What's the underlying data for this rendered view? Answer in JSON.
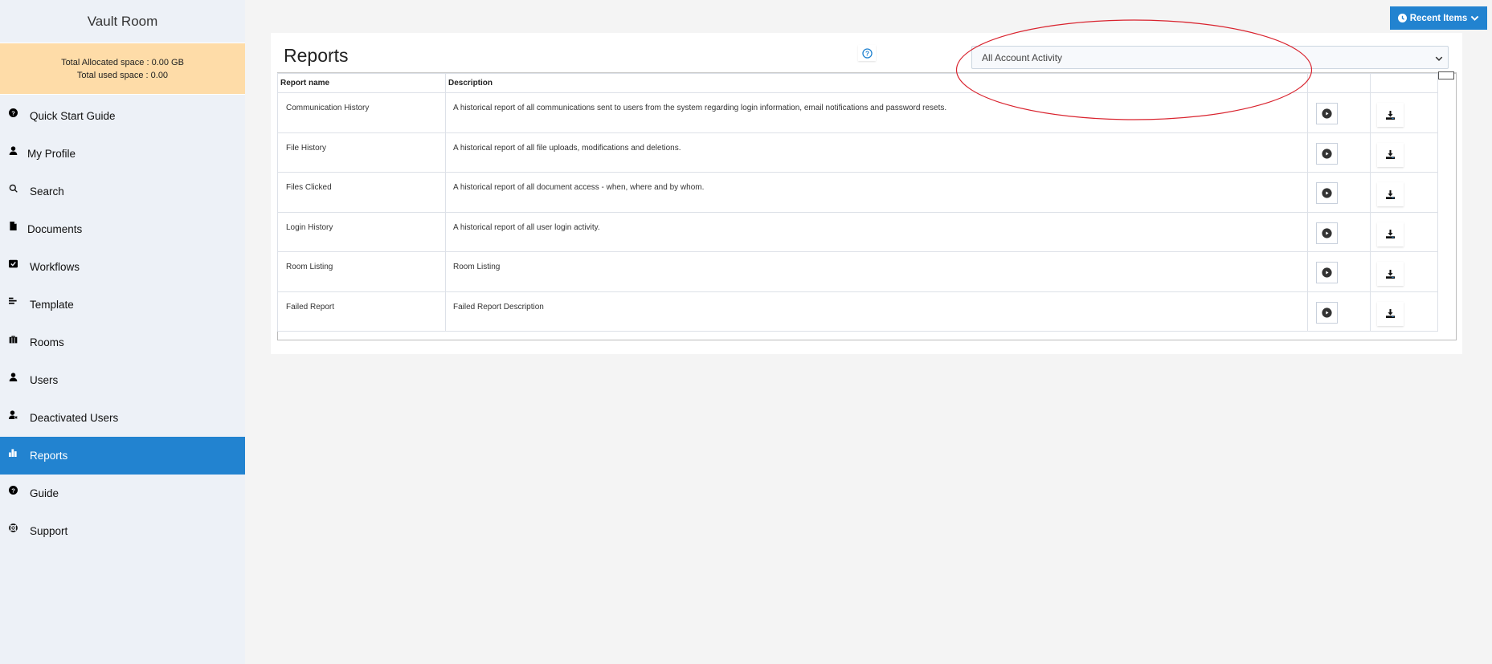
{
  "app": {
    "title": "Vault Room"
  },
  "storage": {
    "allocated": "Total Allocated space : 0.00 GB",
    "used": "Total used space : 0.00"
  },
  "sidebar": {
    "items": [
      {
        "label": "Quick Start Guide",
        "icon": "question-circle-icon",
        "active": false
      },
      {
        "label": "My Profile",
        "icon": "user-icon",
        "active": false
      },
      {
        "label": "Search",
        "icon": "search-icon",
        "active": false
      },
      {
        "label": "Documents",
        "icon": "document-icon",
        "active": false
      },
      {
        "label": "Workflows",
        "icon": "check-square-icon",
        "active": false
      },
      {
        "label": "Template",
        "icon": "align-left-icon",
        "active": false
      },
      {
        "label": "Rooms",
        "icon": "briefcase-icon",
        "active": false
      },
      {
        "label": "Users",
        "icon": "user-icon",
        "active": false
      },
      {
        "label": "Deactivated Users",
        "icon": "user-times-icon",
        "active": false
      },
      {
        "label": "Reports",
        "icon": "bar-chart-icon",
        "active": true
      },
      {
        "label": "Guide",
        "icon": "question-circle-icon",
        "active": false
      },
      {
        "label": "Support",
        "icon": "life-ring-icon",
        "active": false
      }
    ]
  },
  "header": {
    "recent_items_label": "Recent Items"
  },
  "main": {
    "title": "Reports",
    "filter": {
      "selected": "All Account Activity"
    },
    "table": {
      "columns": [
        "Report name",
        "Description",
        "",
        ""
      ],
      "rows": [
        {
          "name": "Communication History",
          "description": "A historical report of all communications sent to users from the system regarding login information, email notifications and password resets."
        },
        {
          "name": "File History",
          "description": "A historical report of all file uploads, modifications and deletions."
        },
        {
          "name": "Files Clicked",
          "description": "A historical report of all document access - when, where and by whom."
        },
        {
          "name": "Login History",
          "description": "A historical report of all user login activity."
        },
        {
          "name": "Room Listing",
          "description": "Room Listing"
        },
        {
          "name": "Failed Report",
          "description": "Failed Report Description"
        }
      ]
    }
  },
  "colors": {
    "accent": "#2283d0",
    "storage_bg": "#fedca8",
    "sidebar_bg": "#edf1f7",
    "annotation": "#d9232e"
  }
}
